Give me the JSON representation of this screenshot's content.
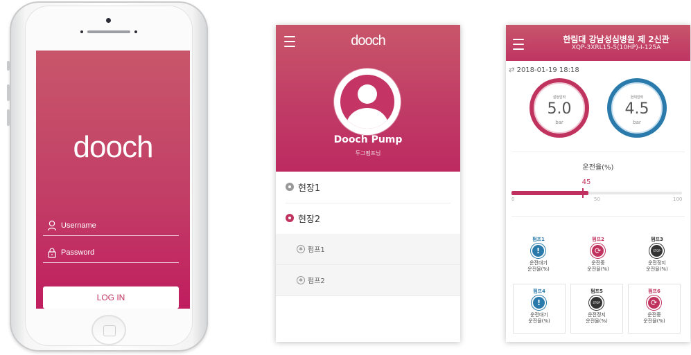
{
  "colors": {
    "brand": "#c0335e",
    "blue": "#2a7bab",
    "dark": "#333333"
  },
  "login": {
    "logo": "dooch",
    "username_placeholder": "Username",
    "password_placeholder": "Password",
    "login_button": "LOG IN"
  },
  "menu": {
    "logo": "dooch",
    "user_name": "Dooch Pump",
    "user_subtitle": "두그펌프님",
    "sites": [
      {
        "label": "현장1",
        "icon": "pin-icon",
        "color": "#999999"
      },
      {
        "label": "현장2",
        "icon": "pin-icon",
        "color": "#c0335e"
      }
    ],
    "pumps": [
      {
        "label": "펌프1"
      },
      {
        "label": "펌프2"
      }
    ]
  },
  "dashboard": {
    "title": "한림대 강남성심병원 제 2신관",
    "subtitle": "XQP-3XRL15-5(10HP)-I-125A",
    "datetime": "2018-01-19 18:18",
    "gauges": [
      {
        "label": "설정압력",
        "value": "5.0",
        "unit": "bar",
        "color": "#c0335e"
      },
      {
        "label": "현재압력",
        "value": "4.5",
        "unit": "bar",
        "color": "#2a7bab"
      }
    ],
    "rate": {
      "title": "운전율(%)",
      "value": "45",
      "min": "0",
      "mid": "50",
      "max": "100",
      "fraction": 0.45
    },
    "pumps": [
      {
        "name": "펌프1",
        "status": "운전대기",
        "rate_label": "운전율(%)",
        "icon": "info-icon"
      },
      {
        "name": "펌프2",
        "status": "운전중",
        "rate_label": "운전율(%)",
        "icon": "running-icon"
      },
      {
        "name": "펌프3",
        "status": "운전정지",
        "rate_label": "운전율(%)",
        "icon": "stop-icon",
        "icon_text": "STOP"
      },
      {
        "name": "펌프4",
        "status": "운전대기",
        "rate_label": "운전율(%)",
        "icon": "info-icon"
      },
      {
        "name": "펌프5",
        "status": "운전정지",
        "rate_label": "운전율(%)",
        "icon": "stop-icon",
        "icon_text": "STOP"
      },
      {
        "name": "펌프6",
        "status": "운전중",
        "rate_label": "운전율(%)",
        "icon": "running-icon"
      }
    ]
  }
}
